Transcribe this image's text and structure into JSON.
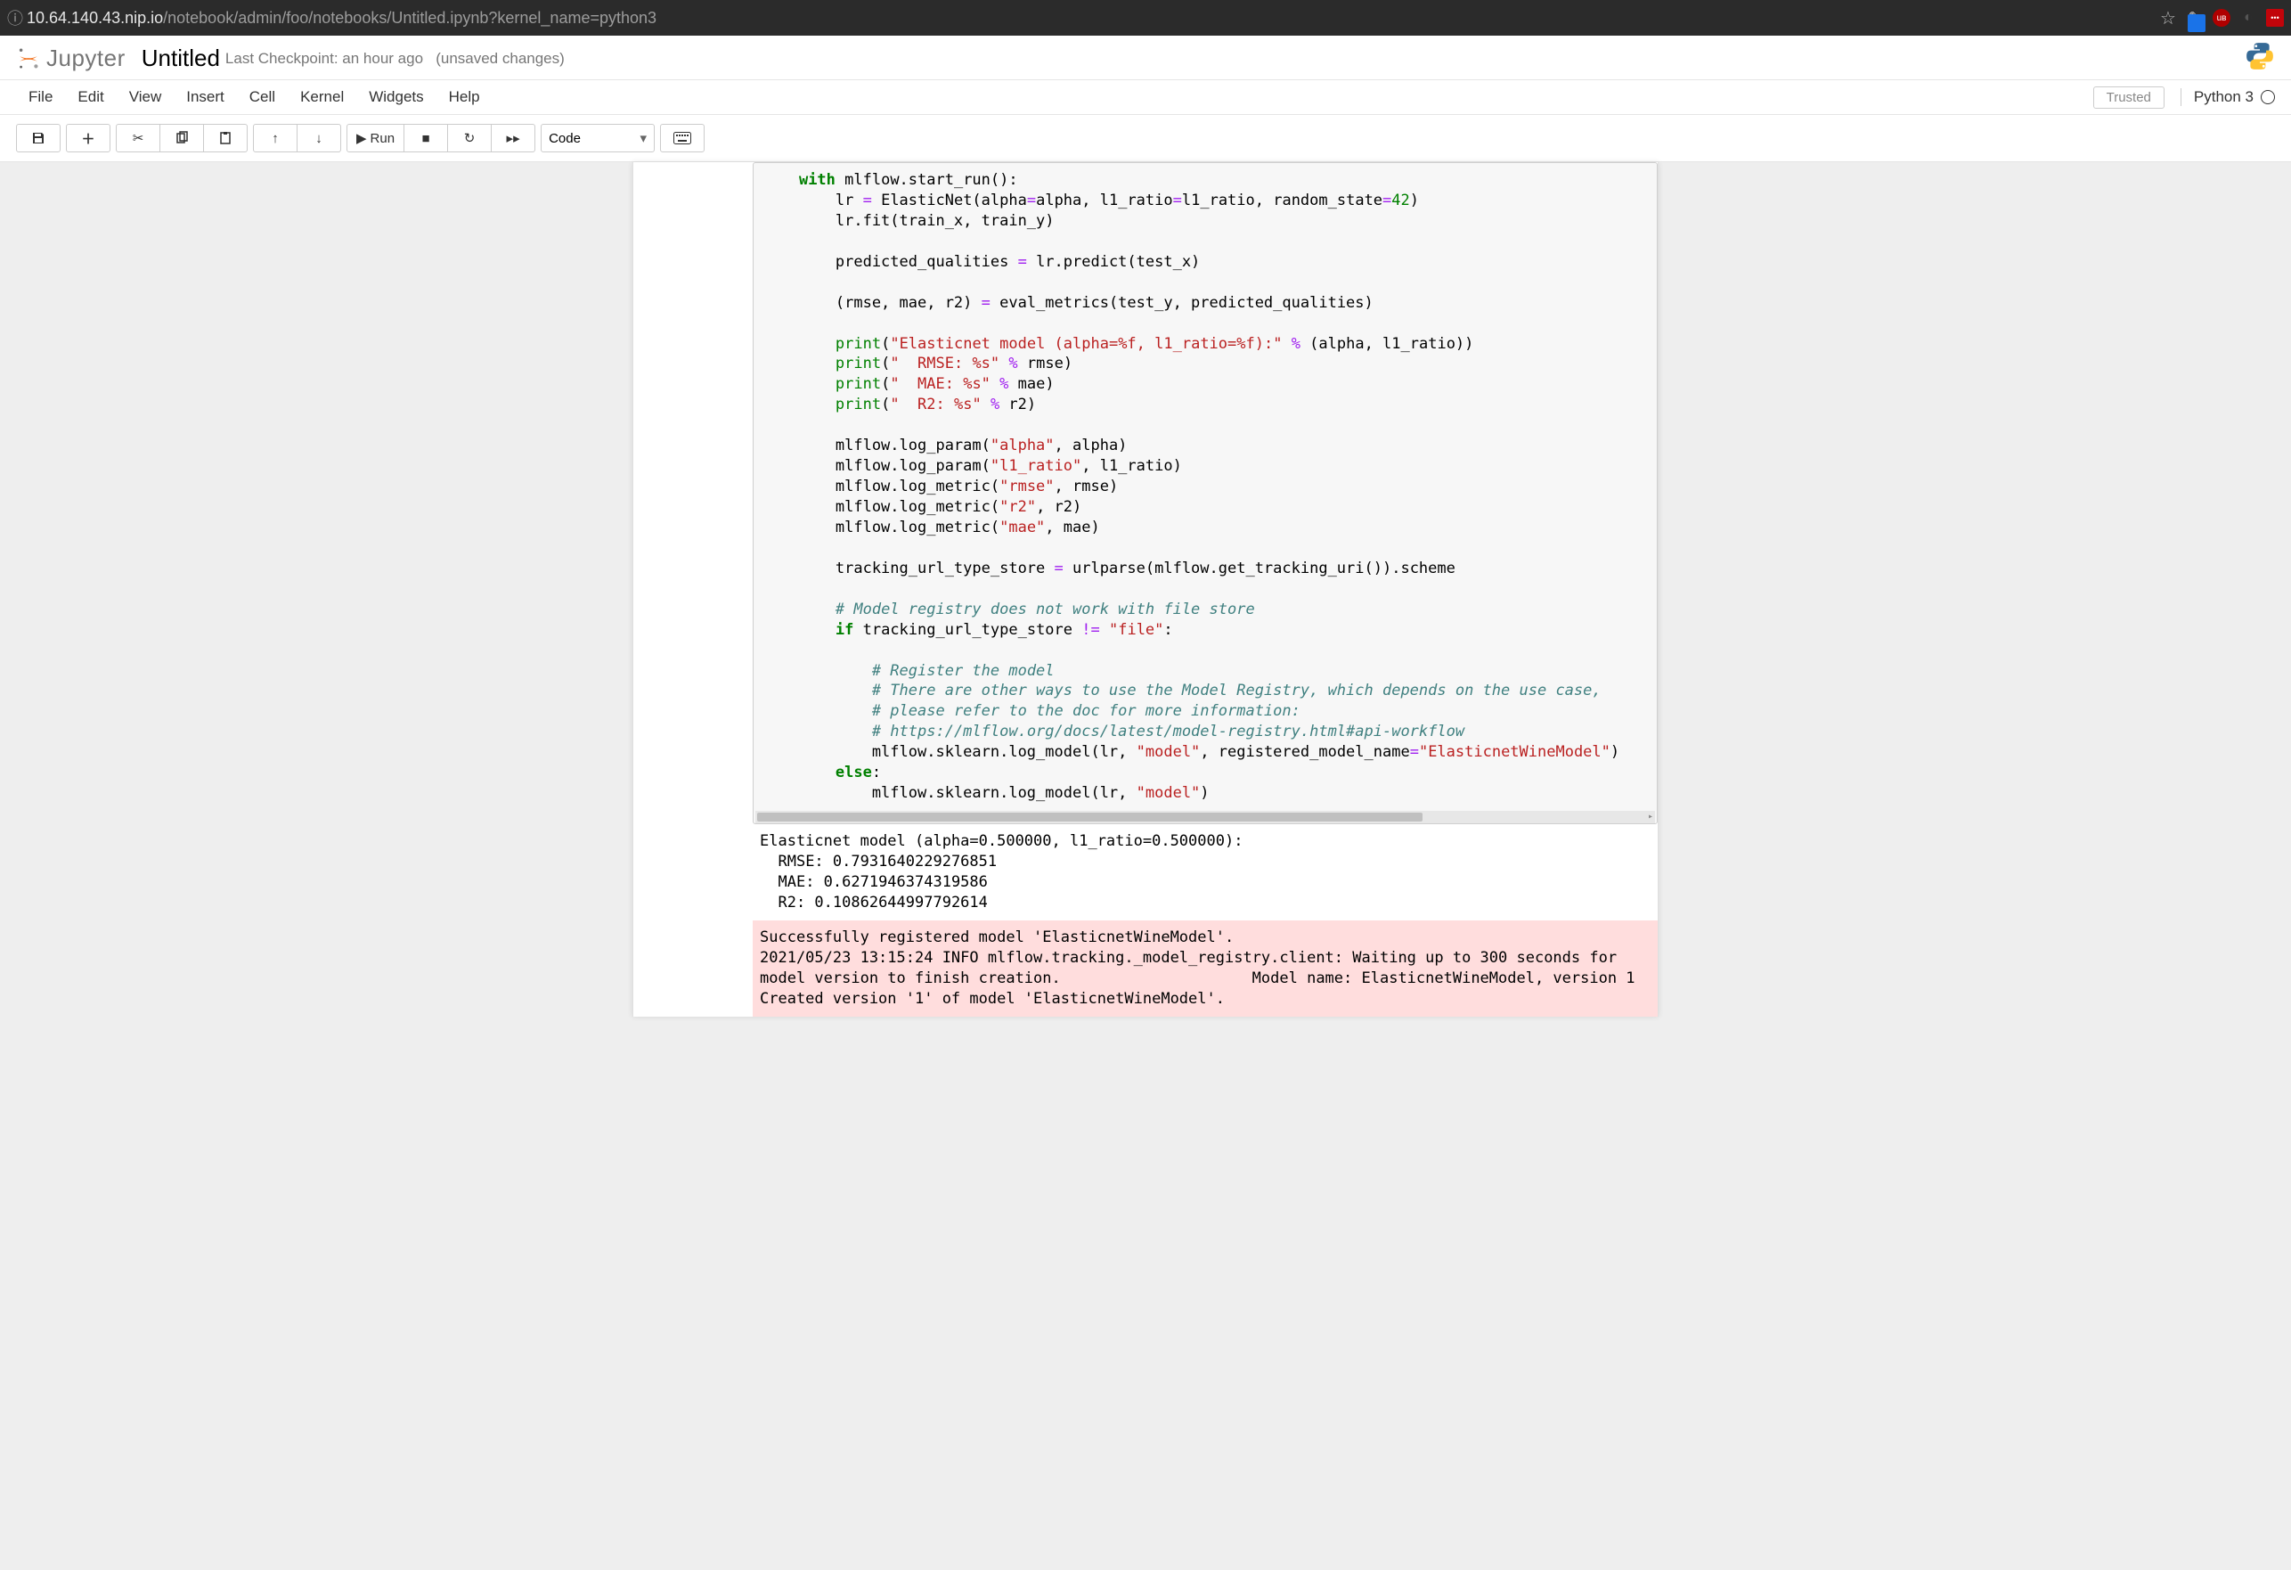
{
  "browser": {
    "url_host": "10.64.140.43.nip.io",
    "url_path": "/notebook/admin/foo/notebooks/Untitled.ipynb?kernel_name=python3"
  },
  "header": {
    "logo_text": "Jupyter",
    "notebook_title": "Untitled",
    "checkpoint": "Last Checkpoint: an hour ago",
    "unsaved": "(unsaved changes)"
  },
  "menu": {
    "items": [
      "File",
      "Edit",
      "View",
      "Insert",
      "Cell",
      "Kernel",
      "Widgets",
      "Help"
    ],
    "trusted": "Trusted",
    "kernel": "Python 3"
  },
  "toolbar": {
    "run_label": "Run",
    "celltype": "Code"
  },
  "code_tokens": [
    [
      "    ",
      {
        "t": "kw",
        "v": "with"
      },
      " mlflow.start_run():"
    ],
    [
      "        lr ",
      {
        "t": "op",
        "v": "="
      },
      " ElasticNet(alpha",
      {
        "t": "op",
        "v": "="
      },
      "alpha, l1_ratio",
      {
        "t": "op",
        "v": "="
      },
      "l1_ratio, random_state",
      {
        "t": "op",
        "v": "="
      },
      {
        "t": "num",
        "v": "42"
      },
      ")"
    ],
    [
      "        lr.fit(train_x, train_y)"
    ],
    [
      ""
    ],
    [
      "        predicted_qualities ",
      {
        "t": "op",
        "v": "="
      },
      " lr.predict(test_x)"
    ],
    [
      ""
    ],
    [
      "        (rmse, mae, r2) ",
      {
        "t": "op",
        "v": "="
      },
      " eval_metrics(test_y, predicted_qualities)"
    ],
    [
      ""
    ],
    [
      "        ",
      {
        "t": "builtin",
        "v": "print"
      },
      "(",
      {
        "t": "str",
        "v": "\"Elasticnet model (alpha=%f, l1_ratio=%f):\""
      },
      " ",
      {
        "t": "op",
        "v": "%"
      },
      " (alpha, l1_ratio))"
    ],
    [
      "        ",
      {
        "t": "builtin",
        "v": "print"
      },
      "(",
      {
        "t": "str",
        "v": "\"  RMSE: %s\""
      },
      " ",
      {
        "t": "op",
        "v": "%"
      },
      " rmse)"
    ],
    [
      "        ",
      {
        "t": "builtin",
        "v": "print"
      },
      "(",
      {
        "t": "str",
        "v": "\"  MAE: %s\""
      },
      " ",
      {
        "t": "op",
        "v": "%"
      },
      " mae)"
    ],
    [
      "        ",
      {
        "t": "builtin",
        "v": "print"
      },
      "(",
      {
        "t": "str",
        "v": "\"  R2: %s\""
      },
      " ",
      {
        "t": "op",
        "v": "%"
      },
      " r2)"
    ],
    [
      ""
    ],
    [
      "        mlflow.log_param(",
      {
        "t": "str",
        "v": "\"alpha\""
      },
      ", alpha)"
    ],
    [
      "        mlflow.log_param(",
      {
        "t": "str",
        "v": "\"l1_ratio\""
      },
      ", l1_ratio)"
    ],
    [
      "        mlflow.log_metric(",
      {
        "t": "str",
        "v": "\"rmse\""
      },
      ", rmse)"
    ],
    [
      "        mlflow.log_metric(",
      {
        "t": "str",
        "v": "\"r2\""
      },
      ", r2)"
    ],
    [
      "        mlflow.log_metric(",
      {
        "t": "str",
        "v": "\"mae\""
      },
      ", mae)"
    ],
    [
      ""
    ],
    [
      "        tracking_url_type_store ",
      {
        "t": "op",
        "v": "="
      },
      " urlparse(mlflow.get_tracking_uri()).scheme"
    ],
    [
      ""
    ],
    [
      "        ",
      {
        "t": "com",
        "v": "# Model registry does not work with file store"
      }
    ],
    [
      "        ",
      {
        "t": "kw",
        "v": "if"
      },
      " tracking_url_type_store ",
      {
        "t": "op",
        "v": "!="
      },
      " ",
      {
        "t": "str",
        "v": "\"file\""
      },
      ":"
    ],
    [
      ""
    ],
    [
      "            ",
      {
        "t": "com",
        "v": "# Register the model"
      }
    ],
    [
      "            ",
      {
        "t": "com",
        "v": "# There are other ways to use the Model Registry, which depends on the use case,"
      }
    ],
    [
      "            ",
      {
        "t": "com",
        "v": "# please refer to the doc for more information:"
      }
    ],
    [
      "            ",
      {
        "t": "com",
        "v": "# https://mlflow.org/docs/latest/model-registry.html#api-workflow"
      }
    ],
    [
      "            mlflow.sklearn.log_model(lr, ",
      {
        "t": "str",
        "v": "\"model\""
      },
      ", registered_model_name",
      {
        "t": "op",
        "v": "="
      },
      {
        "t": "str",
        "v": "\"ElasticnetWineModel\""
      },
      ")"
    ],
    [
      "        ",
      {
        "t": "kw",
        "v": "else"
      },
      ":"
    ],
    [
      "            mlflow.sklearn.log_model(lr, ",
      {
        "t": "str",
        "v": "\"model\""
      },
      ")"
    ]
  ],
  "stdout": "Elasticnet model (alpha=0.500000, l1_ratio=0.500000):\n  RMSE: 0.7931640229276851\n  MAE: 0.6271946374319586\n  R2: 0.10862644997792614",
  "stderr": "Successfully registered model 'ElasticnetWineModel'.\n2021/05/23 13:15:24 INFO mlflow.tracking._model_registry.client: Waiting up to 300 seconds for model version to finish creation.                     Model name: ElasticnetWineModel, version 1\nCreated version '1' of model 'ElasticnetWineModel'."
}
